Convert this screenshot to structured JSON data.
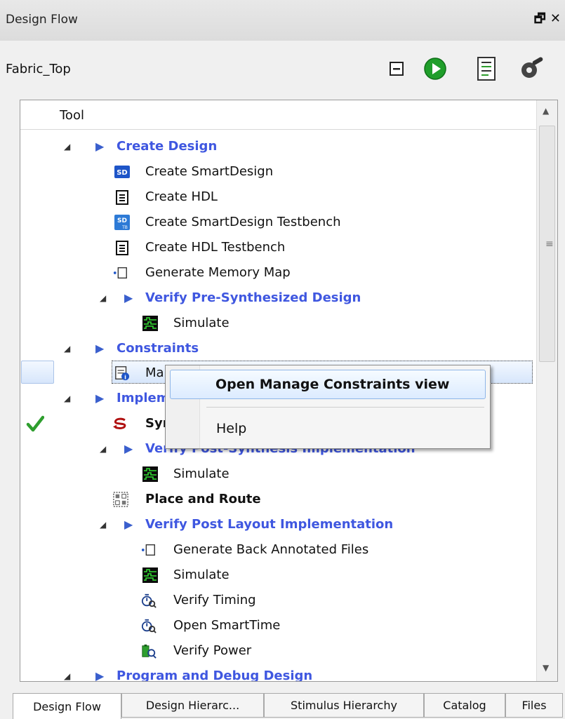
{
  "window": {
    "title": "Design Flow",
    "controls": "🗗 ✕"
  },
  "top": {
    "label": "Fabric_Top"
  },
  "tree": {
    "column": "Tool",
    "rows": [
      {
        "label": "Create Design",
        "style": "blue"
      },
      {
        "label": "Create SmartDesign",
        "style": "normal"
      },
      {
        "label": "Create HDL",
        "style": "normal"
      },
      {
        "label": "Create SmartDesign Testbench",
        "style": "normal"
      },
      {
        "label": "Create HDL Testbench",
        "style": "normal"
      },
      {
        "label": "Generate Memory Map",
        "style": "normal"
      },
      {
        "label": "Verify Pre-Synthesized Design",
        "style": "blue"
      },
      {
        "label": "Simulate",
        "style": "normal"
      },
      {
        "label": "Constraints",
        "style": "blue"
      },
      {
        "label": "Manage Constraints",
        "style": "normal"
      },
      {
        "label": "Implement Design",
        "style": "blue"
      },
      {
        "label": "Synthesize",
        "style": "bold"
      },
      {
        "label": "Verify Post-Synthesis Implementation",
        "style": "blue"
      },
      {
        "label": "Simulate",
        "style": "normal"
      },
      {
        "label": "Place and Route",
        "style": "bold"
      },
      {
        "label": "Verify Post Layout Implementation",
        "style": "blue"
      },
      {
        "label": "Generate Back Annotated Files",
        "style": "normal"
      },
      {
        "label": "Simulate",
        "style": "normal"
      },
      {
        "label": "Verify Timing",
        "style": "normal"
      },
      {
        "label": "Open SmartTime",
        "style": "normal"
      },
      {
        "label": "Verify Power",
        "style": "normal"
      },
      {
        "label": "Program and Debug Design",
        "style": "blue"
      }
    ]
  },
  "context_menu": {
    "item1": "Open Manage Constraints view",
    "item2": "Help"
  },
  "tabs": [
    "Design Flow",
    "Design Hierarc...",
    "Stimulus Hierarchy",
    "Catalog",
    "Files"
  ],
  "colors": {
    "accent": "#3f57e0",
    "check": "#2e9e2e",
    "selection": "#d7e6fb"
  }
}
